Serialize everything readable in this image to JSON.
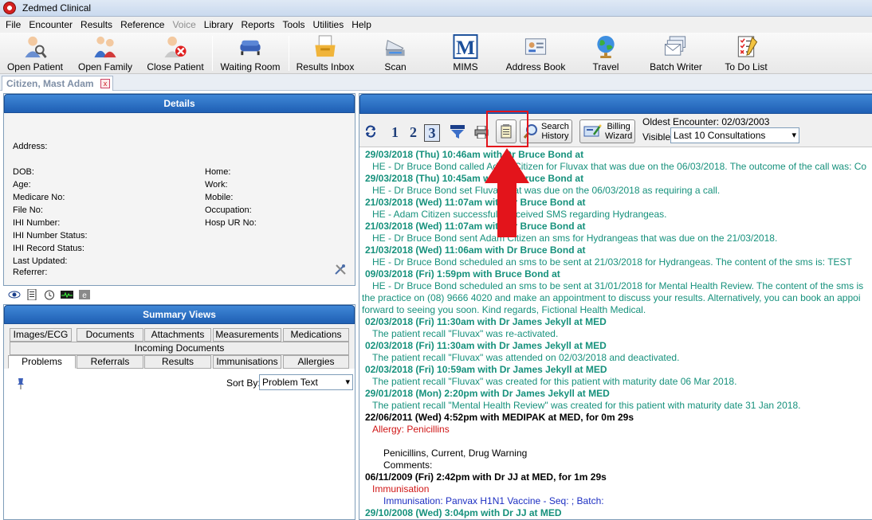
{
  "window": {
    "title": "Zedmed Clinical"
  },
  "menu": [
    "File",
    "Encounter",
    "Results",
    "Reference",
    "Voice",
    "Library",
    "Reports",
    "Tools",
    "Utilities",
    "Help"
  ],
  "toolbar": {
    "open_patient": "Open Patient",
    "open_family": "Open Family",
    "close_patient": "Close Patient",
    "waiting_room": "Waiting Room",
    "results_inbox": "Results Inbox",
    "scan": "Scan",
    "mims": "MIMS",
    "mims_logo": "M",
    "address_book": "Address Book",
    "travel": "Travel",
    "batch_writer": "Batch Writer",
    "todo": "To Do List"
  },
  "patient_tab": {
    "label": "Citizen, Mast Adam",
    "close": "x"
  },
  "details": {
    "title": "Details",
    "address": "Address:",
    "dob": "DOB:",
    "age": "Age:",
    "medicare": "Medicare No:",
    "file": "File No:",
    "ihi": "IHI Number:",
    "ihi_status": "IHI Number Status:",
    "ihi_record": "IHI Record Status:",
    "last_updated": "Last Updated:",
    "referrer": "Referrer:",
    "home": "Home:",
    "work": "Work:",
    "mobile": "Mobile:",
    "occupation": "Occupation:",
    "hosp_ur": "Hosp UR No:"
  },
  "summary": {
    "title": "Summary Views",
    "tabs_row1": [
      "Images/ECG",
      "Documents",
      "Attachments",
      "Measurements",
      "Medications"
    ],
    "tabs_row2": [
      "Incoming Documents"
    ],
    "tabs_row3": [
      "Problems",
      "Referrals",
      "Results",
      "Immunisations",
      "Allergies"
    ],
    "sort_by": "Sort By:",
    "sort_value": "Problem Text"
  },
  "history": {
    "view_nums": [
      "1",
      "2",
      "3"
    ],
    "search_history": [
      "Search",
      "History"
    ],
    "billing_wizard": [
      "Billing",
      "Wizard"
    ],
    "oldest": "Oldest Encounter: 02/03/2003",
    "visible": "Visible:",
    "visible_value": "Last 10 Consultations",
    "entries": [
      {
        "cls": "h-head-teal",
        "text": "29/03/2018 (Thu) 10:46am with Dr Bruce Bond at"
      },
      {
        "cls": "h-body-teal",
        "text": "HE - Dr Bruce Bond called Adam Citizen for Fluvax that was due on the 06/03/2018. The outcome of the call was: Co"
      },
      {
        "cls": "h-head-teal",
        "text": "29/03/2018 (Thu) 10:45am with Dr Bruce Bond at"
      },
      {
        "cls": "h-body-teal",
        "text": "HE - Dr Bruce Bond set Fluvax that was due on the 06/03/2018 as requiring a call."
      },
      {
        "cls": "h-head-teal",
        "text": "21/03/2018 (Wed) 11:07am with Dr Bruce Bond at"
      },
      {
        "cls": "h-body-teal",
        "text": "HE - Adam Citizen successfully received SMS regarding Hydrangeas."
      },
      {
        "cls": "h-head-teal",
        "text": "21/03/2018 (Wed) 11:07am with Dr Bruce Bond at"
      },
      {
        "cls": "h-body-teal",
        "text": "HE - Dr Bruce Bond sent Adam Citizen an sms for Hydrangeas that was due on the 21/03/2018."
      },
      {
        "cls": "h-head-teal",
        "text": "21/03/2018 (Wed) 11:06am with Dr Bruce Bond at"
      },
      {
        "cls": "h-body-teal",
        "text": "HE - Dr Bruce Bond scheduled an sms to be sent at 21/03/2018 for Hydrangeas. The content of the sms is: TEST"
      },
      {
        "cls": "h-head-teal",
        "text": "09/03/2018 (Fri) 1:59pm with Bruce Bond at"
      },
      {
        "cls": "h-body-teal",
        "text": "HE - Dr Bruce Bond scheduled an sms to be sent at 31/01/2018 for Mental Health Review. The content of the sms is"
      },
      {
        "cls": "h-wrap-teal",
        "text": "the practice on (08) 9666 4020 and make an appointment to discuss your results. Alternatively, you can book an appoi"
      },
      {
        "cls": "h-wrap-teal",
        "text": "forward to seeing you soon. Kind regards, Fictional Health Medical."
      },
      {
        "cls": "h-head-teal",
        "text": "02/03/2018 (Fri) 11:30am with Dr James Jekyll at MED"
      },
      {
        "cls": "h-body-teal",
        "text": "The patient recall \"Fluvax\" was re-activated."
      },
      {
        "cls": "h-head-teal",
        "text": "02/03/2018 (Fri) 11:30am with Dr James Jekyll at MED"
      },
      {
        "cls": "h-body-teal",
        "text": "The patient recall \"Fluvax\" was attended on 02/03/2018 and deactivated."
      },
      {
        "cls": "h-head-teal",
        "text": "02/03/2018 (Fri) 10:59am with Dr James Jekyll at MED"
      },
      {
        "cls": "h-body-teal",
        "text": "The patient recall \"Fluvax\" was created for this patient with maturity date 06 Mar 2018."
      },
      {
        "cls": "h-head-teal",
        "text": "29/01/2018 (Mon) 2:20pm with Dr James Jekyll at MED"
      },
      {
        "cls": "h-body-teal",
        "text": "The patient recall \"Mental Health Review\" was created for this patient with maturity date 31 Jan 2018."
      },
      {
        "cls": "h-head-black",
        "text": "22/06/2011 (Wed) 4:52pm with MEDIPAK at MED, for 0m 29s"
      },
      {
        "cls": "h-red",
        "text": "Allergy: Penicillins"
      },
      {
        "cls": "h-blank",
        "text": ""
      },
      {
        "cls": "h-black",
        "text": "Penicillins, Current, Drug Warning"
      },
      {
        "cls": "h-black",
        "text": "Comments:"
      },
      {
        "cls": "h-head-black",
        "text": "06/11/2009 (Fri) 2:42pm with Dr JJ at MED, for 1m 29s"
      },
      {
        "cls": "h-red",
        "text": "Immunisation"
      },
      {
        "cls": "h-blue",
        "text": "Immunisation: Panvax H1N1 Vaccine - Seq: ; Batch:"
      },
      {
        "cls": "h-head-teal",
        "text": "29/10/2008 (Wed) 3:04pm with Dr JJ at MED"
      }
    ]
  },
  "colors": {
    "accent": "#1f5fb4",
    "teal": "#16917c",
    "annotation": "#e3141b"
  }
}
